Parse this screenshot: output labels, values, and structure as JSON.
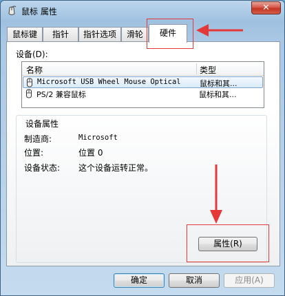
{
  "window": {
    "title": "鼠标 属性",
    "close_glyph": "✕"
  },
  "tabs": [
    {
      "label": "鼠标键"
    },
    {
      "label": "指针"
    },
    {
      "label": "指针选项"
    },
    {
      "label": "滑轮"
    },
    {
      "label": "硬件",
      "selected": true
    }
  ],
  "devices": {
    "label": "设备(D):",
    "columns": [
      "名称",
      "类型"
    ],
    "rows": [
      {
        "name": "Microsoft USB Wheel Mouse Optical",
        "type": "鼠标和其...",
        "selected": true,
        "icon": "mouse-icon"
      },
      {
        "name": "PS/2 兼容鼠标",
        "type": "鼠标和其...",
        "selected": false,
        "icon": "mouse-icon"
      }
    ]
  },
  "device_properties": {
    "title": "设备属性",
    "manufacturer_label": "制造商:",
    "manufacturer_value": "Microsoft",
    "location_label": "位置:",
    "location_value": "位置 0",
    "status_label": "设备状态:",
    "status_value": "这个设备运转正常。",
    "properties_button": "属性(R)"
  },
  "footer": {
    "ok": "确定",
    "cancel": "取消",
    "apply": "应用(A)"
  },
  "annotation_color": "#e53838"
}
